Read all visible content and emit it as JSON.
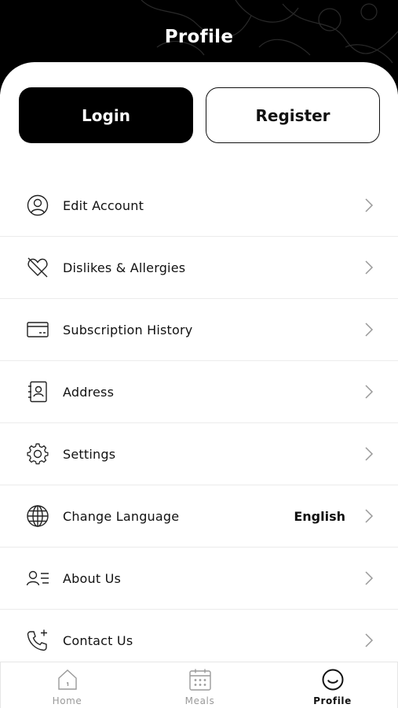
{
  "header": {
    "title": "Profile"
  },
  "auth": {
    "login_label": "Login",
    "register_label": "Register"
  },
  "menu": {
    "items": [
      {
        "label": "Edit Account",
        "icon": "user-circle-icon"
      },
      {
        "label": "Dislikes & Allergies",
        "icon": "heart-off-icon"
      },
      {
        "label": "Subscription History",
        "icon": "credit-card-icon"
      },
      {
        "label": "Address",
        "icon": "address-book-icon"
      },
      {
        "label": "Settings",
        "icon": "gear-icon"
      },
      {
        "label": "Change Language",
        "icon": "globe-icon",
        "value": "English"
      },
      {
        "label": "About Us",
        "icon": "user-list-icon"
      },
      {
        "label": "Contact Us",
        "icon": "phone-plus-icon"
      }
    ]
  },
  "tabbar": {
    "tabs": [
      {
        "label": "Home",
        "icon": "home-icon",
        "active": false
      },
      {
        "label": "Meals",
        "icon": "calendar-icon",
        "active": false
      },
      {
        "label": "Profile",
        "icon": "smile-icon",
        "active": true
      }
    ]
  },
  "colors": {
    "header_bg": "#000000",
    "primary": "#000000",
    "inactive_tab": "#9a9a9a"
  }
}
